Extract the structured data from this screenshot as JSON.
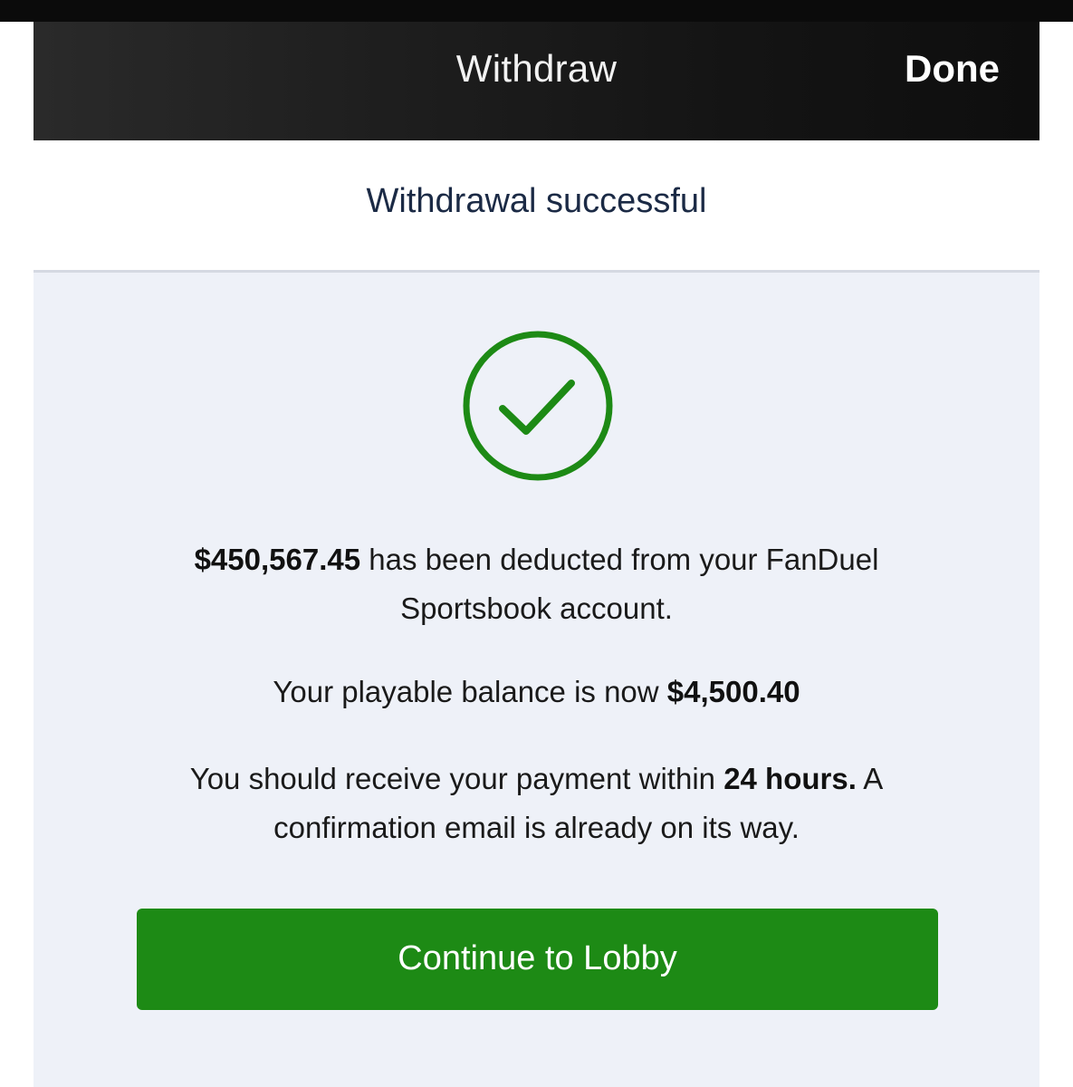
{
  "nav": {
    "title": "Withdraw",
    "done_label": "Done"
  },
  "header": {
    "status_text": "Withdrawal successful"
  },
  "icon": {
    "name": "checkmark-circle-icon",
    "color": "#1d8a15"
  },
  "message": {
    "amount": "$450,567.45",
    "deducted_text_line1": " has been deducted from your FanDuel",
    "deducted_text_line2": "Sportsbook account.",
    "balance_prefix": "Your playable balance is now ",
    "balance_amount": "$4,500.40",
    "payment_prefix": "You should receive your payment within ",
    "payment_time": "24 hours.",
    "payment_suffix": " A",
    "payment_line2": "confirmation email is already on its way."
  },
  "button": {
    "continue_label": "Continue to Lobby"
  },
  "colors": {
    "accent_green": "#1d8a15",
    "nav_bg": "#141414",
    "content_bg": "#eef1f8",
    "header_text": "#1b2a45"
  }
}
